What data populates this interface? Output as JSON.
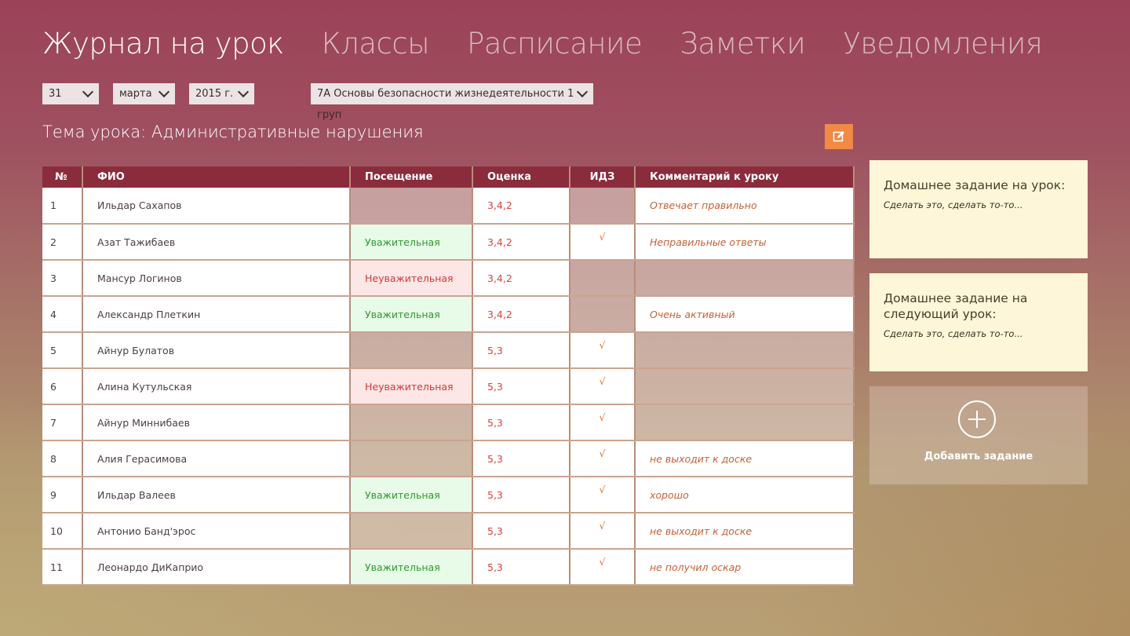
{
  "nav": {
    "items": [
      "Журнал на урок",
      "Классы",
      "Расписание",
      "Заметки",
      "Уведомления"
    ],
    "active": 0
  },
  "filters": {
    "day": "31",
    "month": "марта",
    "year": "2015 г.",
    "lesson": "7А Основы безопасности жизнедеятельности 1 груп"
  },
  "topic": {
    "label": "Тема урока:",
    "value": "Административные нарушения"
  },
  "table": {
    "headers": [
      "№",
      "ФИО",
      "Посещение",
      "Оценка",
      "ИДЗ",
      "Комментарий к уроку"
    ],
    "rows": [
      {
        "num": "1",
        "name": "Ильдар Сахапов",
        "attendance": "",
        "att_status": "none",
        "grade": "3,4,2",
        "idz": "",
        "comment": "Отвечает правильно"
      },
      {
        "num": "2",
        "name": "Азат Тажибаев",
        "attendance": "Уважительная",
        "att_status": "ok",
        "grade": "3,4,2",
        "idz": "√",
        "comment": "Неправильные ответы"
      },
      {
        "num": "3",
        "name": "Мансур Логинов",
        "attendance": "Неуважительная",
        "att_status": "bad",
        "grade": "3,4,2",
        "idz": "",
        "comment": ""
      },
      {
        "num": "4",
        "name": "Александр Плеткин",
        "attendance": "Уважительная",
        "att_status": "ok",
        "grade": "3,4,2",
        "idz": "",
        "comment": "Очень активный"
      },
      {
        "num": "5",
        "name": "Айнур Булатов",
        "attendance": "",
        "att_status": "none",
        "grade": "5,3",
        "idz": "√",
        "comment": ""
      },
      {
        "num": "6",
        "name": "Алина Кутульская",
        "attendance": "Неуважительная",
        "att_status": "bad",
        "grade": "5,3",
        "idz": "√",
        "comment": ""
      },
      {
        "num": "7",
        "name": "Айнур Миннибаев",
        "attendance": "",
        "att_status": "none",
        "grade": "5,3",
        "idz": "√",
        "comment": ""
      },
      {
        "num": "8",
        "name": "Алия Герасимова",
        "attendance": "",
        "att_status": "none",
        "grade": "5,3",
        "idz": "√",
        "comment": "не выходит к доске"
      },
      {
        "num": "9",
        "name": "Ильдар Валеев",
        "attendance": "Уважительная",
        "att_status": "ok",
        "grade": "5,3",
        "idz": "√",
        "comment": "хорошо"
      },
      {
        "num": "10",
        "name": "Антонио Банд'эрос",
        "attendance": "",
        "att_status": "none",
        "grade": "5,3",
        "idz": "√",
        "comment": "не выходит к доске"
      },
      {
        "num": "11",
        "name": "Леонардо ДиКаприо",
        "attendance": "Уважительная",
        "att_status": "ok",
        "grade": "5,3",
        "idz": "√",
        "comment": "не получил оскар"
      }
    ]
  },
  "homework": {
    "current_title": "Домашнее задание на урок:",
    "current_text": "Сделать это, сделать то-то...",
    "next_title": "Домашнее задание на следующий урок:",
    "next_text": "Сделать это, сделать то-то...",
    "add_label": "Добавить задание"
  },
  "colors": {
    "header_bg": "#8a2c3c",
    "accent_orange": "#f08a45",
    "attendance_ok": "#2e9b2e",
    "attendance_bad": "#d03a3a",
    "card_bg": "#fdf6d8"
  },
  "icons": {
    "edit": "edit-icon",
    "chevron": "chevron-down-icon",
    "add": "plus-circle-icon"
  }
}
